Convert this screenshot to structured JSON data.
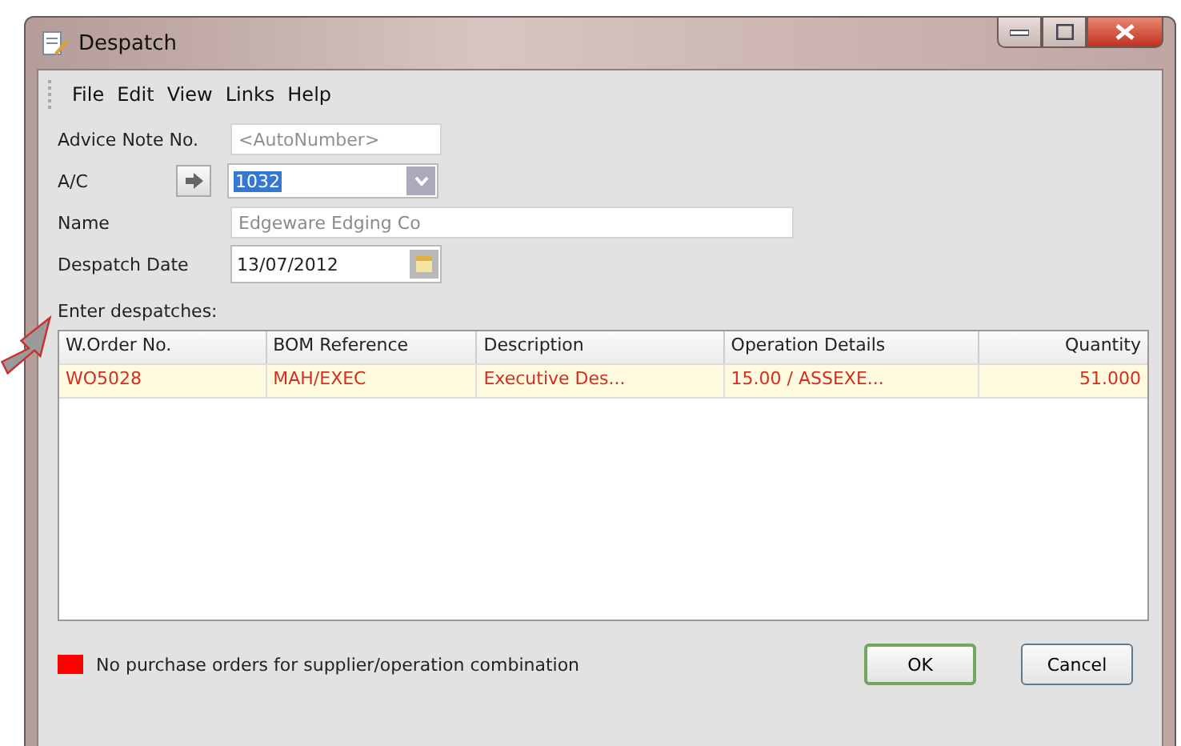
{
  "window": {
    "title": "Despatch"
  },
  "menu": [
    "File",
    "Edit",
    "View",
    "Links",
    "Help"
  ],
  "form": {
    "advice_note": {
      "label": "Advice Note No.",
      "placeholder": "<AutoNumber>"
    },
    "account": {
      "label": "A/C",
      "value": "1032",
      "text_selected": true
    },
    "name": {
      "label": "Name",
      "value": "Edgeware Edging Co",
      "disabled": true
    },
    "despatch_date": {
      "label": "Despatch Date",
      "value": "13/07/2012"
    }
  },
  "table": {
    "caption": "Enter despatches:",
    "columns": [
      "W.Order No.",
      "BOM Reference",
      "Description",
      "Operation Details",
      "Quantity"
    ],
    "rows": [
      {
        "cells": [
          "WO5028",
          "MAH/EXEC",
          "Executive Des...",
          "15.00 / ASSEXE...",
          "51.000"
        ],
        "selected": true,
        "flagged": true
      }
    ]
  },
  "legend": {
    "color": "#ff0000",
    "text": "No purchase orders for supplier/operation combination"
  },
  "buttons": [
    {
      "label": "OK",
      "default": true
    },
    {
      "label": "Cancel",
      "default": false
    }
  ]
}
